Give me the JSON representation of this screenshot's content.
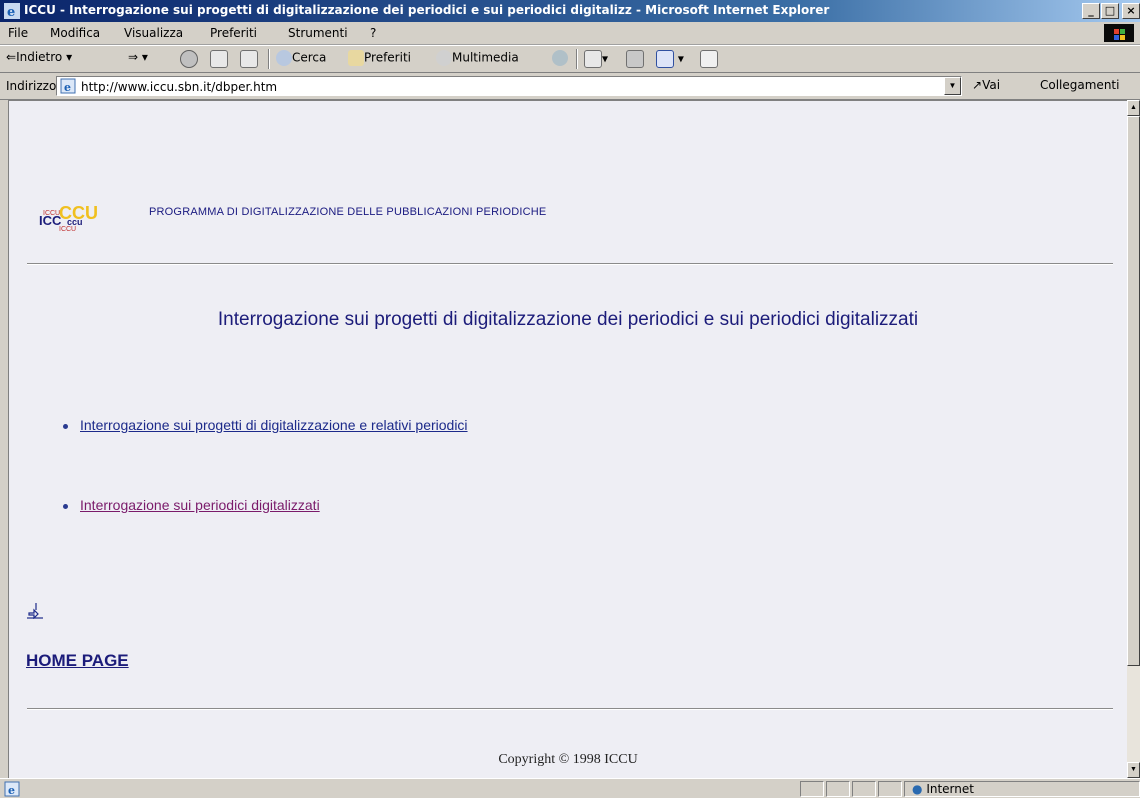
{
  "window": {
    "title": "ICCU - Interrogazione sui progetti di digitalizzazione dei periodici e sui periodici digitalizz - Microsoft Internet Explorer",
    "min": "_",
    "max": "□",
    "close": "×"
  },
  "menu": {
    "items": [
      "File",
      "Modifica",
      "Visualizza",
      "Preferiti",
      "Strumenti",
      "?"
    ]
  },
  "toolbar": {
    "back": "Indietro",
    "search": "Cerca",
    "favorites": "Preferiti",
    "media": "Multimedia"
  },
  "address": {
    "label": "Indirizzo",
    "url": "http://www.iccu.sbn.it/dbper.htm",
    "go": "Vai",
    "links": "Collegamenti"
  },
  "page": {
    "logo_text": "ICCU",
    "program_title": "PROGRAMMA DI DIGITALIZZAZIONE DELLE PUBBLICAZIONI PERIODICHE",
    "heading": "Interrogazione sui progetti di digitalizzazione dei periodici e sui periodici digitalizzati",
    "links": [
      "Interrogazione sui progetti di digitalizzazione e relativi periodici",
      "Interrogazione sui periodici digitalizzati"
    ],
    "home": "HOME PAGE",
    "copyright": "Copyright © 1998 ICCU"
  },
  "status": {
    "zone": "Internet"
  },
  "colors": {
    "link": "#1c2a8a",
    "visited": "#7a1a6a",
    "heading": "#1c1c7a",
    "page_bg": "#eeeef4"
  }
}
